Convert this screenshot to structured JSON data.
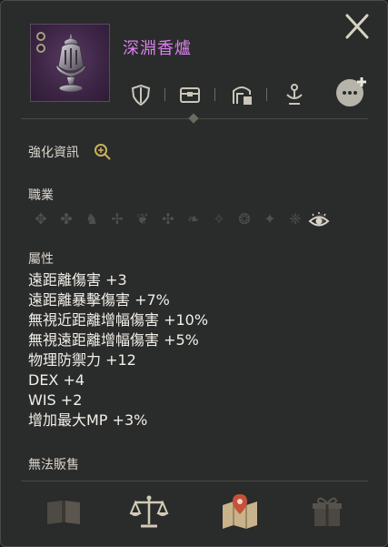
{
  "item": {
    "name": "深淵香爐",
    "name_color": "#d980ee"
  },
  "sections": {
    "enhance": "強化資訊",
    "job": "職業",
    "attributes": "屬性",
    "sell_status": "無法販售"
  },
  "stats": [
    "遠距離傷害 +3",
    "遠距離暴擊傷害 +7%",
    "無視近距離增幅傷害 +10%",
    "無視遠距離增幅傷害 +5%",
    "物理防禦力 +12",
    "DEX +4",
    "WIS +2",
    "增加最大MP +3%"
  ],
  "icons": {
    "close": "close-icon",
    "top_actions": [
      "shield-icon",
      "chest-icon",
      "warehouse-icon",
      "lamp-icon",
      "chat-plus-icon"
    ],
    "bottom_actions": [
      "book-icon",
      "scales-icon",
      "map-pin-icon",
      "gift-box-icon"
    ]
  }
}
